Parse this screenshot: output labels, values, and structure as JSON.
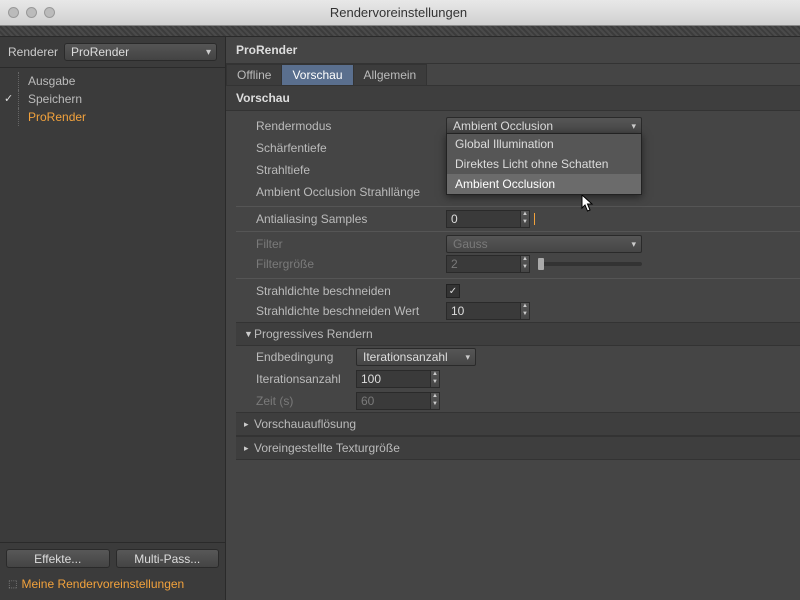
{
  "window": {
    "title": "Rendervoreinstellungen"
  },
  "left": {
    "renderer_label": "Renderer",
    "renderer_value": "ProRender",
    "tree": {
      "ausgabe": "Ausgabe",
      "speichern": "Speichern",
      "prorender": "ProRender"
    },
    "effects_btn": "Effekte...",
    "multipass_btn": "Multi-Pass...",
    "my_settings": "Meine Rendervoreinstellungen"
  },
  "panel": {
    "title": "ProRender",
    "tabs": {
      "offline": "Offline",
      "vorschau": "Vorschau",
      "allgemein": "Allgemein"
    },
    "section": "Vorschau"
  },
  "fields": {
    "rendermodus": {
      "label": "Rendermodus",
      "value": "Ambient Occlusion"
    },
    "schaerfentiefe": {
      "label": "Schärfentiefe"
    },
    "strahltiefe": {
      "label": "Strahltiefe"
    },
    "ao_strahllaenge": {
      "label": "Ambient Occlusion Strahllänge"
    },
    "aa_samples": {
      "label": "Antialiasing Samples",
      "value": "0"
    },
    "filter": {
      "label": "Filter",
      "value": "Gauss"
    },
    "filtergroesse": {
      "label": "Filtergröße",
      "value": "2"
    },
    "strahldichte_cut": {
      "label": "Strahldichte beschneiden",
      "checked": true
    },
    "strahldichte_cut_wert": {
      "label": "Strahldichte beschneiden Wert",
      "value": "10"
    },
    "progressive_group": "Progressives Rendern",
    "endbedingung": {
      "label": "Endbedingung",
      "value": "Iterationsanzahl"
    },
    "iterationsanzahl": {
      "label": "Iterationsanzahl",
      "value": "100"
    },
    "zeit": {
      "label": "Zeit (s)",
      "value": "60"
    }
  },
  "groups": {
    "vorschauaufloesung": "Vorschauauflösung",
    "voreingestellte_tex": "Voreingestellte Texturgröße"
  },
  "rendermodus_options": [
    "Global Illumination",
    "Direktes Licht ohne Schatten",
    "Ambient Occlusion"
  ]
}
